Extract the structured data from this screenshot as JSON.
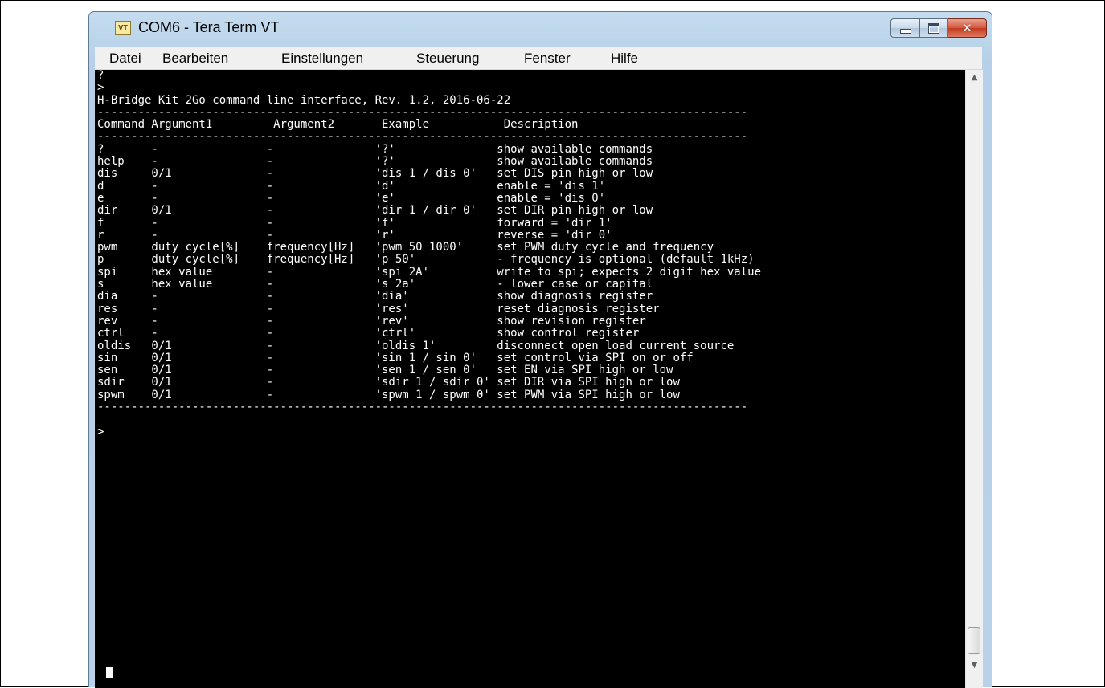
{
  "window": {
    "title": "COM6 - Tera Term VT",
    "icon_label": "VT",
    "buttons": {
      "minimize": "minimize-icon",
      "maximize": "maximize-icon",
      "close": "close-icon"
    }
  },
  "menu": {
    "items": [
      {
        "label": "Datei"
      },
      {
        "label": "Bearbeiten"
      },
      {
        "label": "Einstellungen"
      },
      {
        "label": "Steuerung"
      },
      {
        "label": "Fenster"
      },
      {
        "label": "Hilfe"
      }
    ]
  },
  "terminal": {
    "lines": [
      "?",
      ">",
      "H-Bridge Kit 2Go command line interface, Rev. 1.2, 2016-06-22",
      "------------------------------------------------------------------------------------------------",
      "Command Argument1         Argument2       Example           Description",
      "------------------------------------------------------------------------------------------------",
      "?       -                -               '?'               show available commands",
      "help    -                -               '?'               show available commands",
      "dis     0/1              -               'dis 1 / dis 0'   set DIS pin high or low",
      "d       -                -               'd'               enable = 'dis 1'",
      "e       -                -               'e'               enable = 'dis 0'",
      "dir     0/1              -               'dir 1 / dir 0'   set DIR pin high or low",
      "f       -                -               'f'               forward = 'dir 1'",
      "r       -                -               'r'               reverse = 'dir 0'",
      "pwm     duty cycle[%]    frequency[Hz]   'pwm 50 1000'     set PWM duty cycle and frequency",
      "p       duty cycle[%]    frequency[Hz]   'p 50'            - frequency is optional (default 1kHz)",
      "spi     hex value        -               'spi 2A'          write to spi; expects 2 digit hex value",
      "s       hex value        -               's 2a'            - lower case or capital",
      "dia     -                -               'dia'             show diagnosis register",
      "res     -                -               'res'             reset diagnosis register",
      "rev     -                -               'rev'             show revision register",
      "ctrl    -                -               'ctrl'            show control register",
      "oldis   0/1              -               'oldis 1'         disconnect open load current source",
      "sin     0/1              -               'sin 1 / sin 0'   set control via SPI on or off",
      "sen     0/1              -               'sen 1 / sen 0'   set EN via SPI high or low",
      "sdir    0/1              -               'sdir 1 / sdir 0' set DIR via SPI high or low",
      "spwm    0/1              -               'spwm 1 / spwm 0' set PWM via SPI high or low",
      "------------------------------------------------------------------------------------------------",
      "",
      ">"
    ]
  }
}
